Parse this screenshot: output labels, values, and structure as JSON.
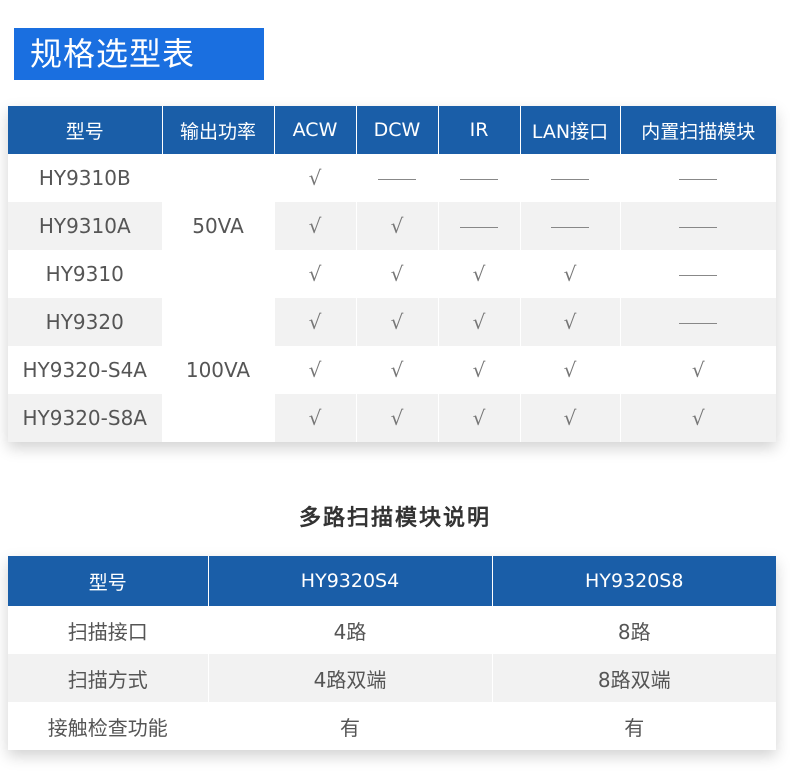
{
  "page": {
    "title": "规格选型表",
    "subtitle": "多路扫描模块说明"
  },
  "spec_table": {
    "headers": [
      "型号",
      "输出功率",
      "ACW",
      "DCW",
      "IR",
      "LAN接口",
      "内置扫描模块"
    ],
    "power_groups": [
      "50VA",
      "100VA"
    ],
    "rows": [
      {
        "model": "HY9310B",
        "acw": "check",
        "dcw": "dash",
        "ir": "dash",
        "lan": "dash",
        "scan": "dash"
      },
      {
        "model": "HY9310A",
        "acw": "check",
        "dcw": "check",
        "ir": "dash",
        "lan": "dash",
        "scan": "dash"
      },
      {
        "model": "HY9310",
        "acw": "check",
        "dcw": "check",
        "ir": "check",
        "lan": "check",
        "scan": "dash"
      },
      {
        "model": "HY9320",
        "acw": "check",
        "dcw": "check",
        "ir": "check",
        "lan": "check",
        "scan": "dash"
      },
      {
        "model": "HY9320-S4A",
        "acw": "check",
        "dcw": "check",
        "ir": "check",
        "lan": "check",
        "scan": "check"
      },
      {
        "model": "HY9320-S8A",
        "acw": "check",
        "dcw": "check",
        "ir": "check",
        "lan": "check",
        "scan": "check"
      }
    ]
  },
  "scan_table": {
    "headers": [
      "型号",
      "HY9320S4",
      "HY9320S8"
    ],
    "rows": [
      {
        "label": "扫描接口",
        "s4": "4路",
        "s8": "8路"
      },
      {
        "label": "扫描方式",
        "s4": "4路双端",
        "s8": "8路双端"
      },
      {
        "label": "接触检查功能",
        "s4": "有",
        "s8": "有"
      }
    ]
  }
}
